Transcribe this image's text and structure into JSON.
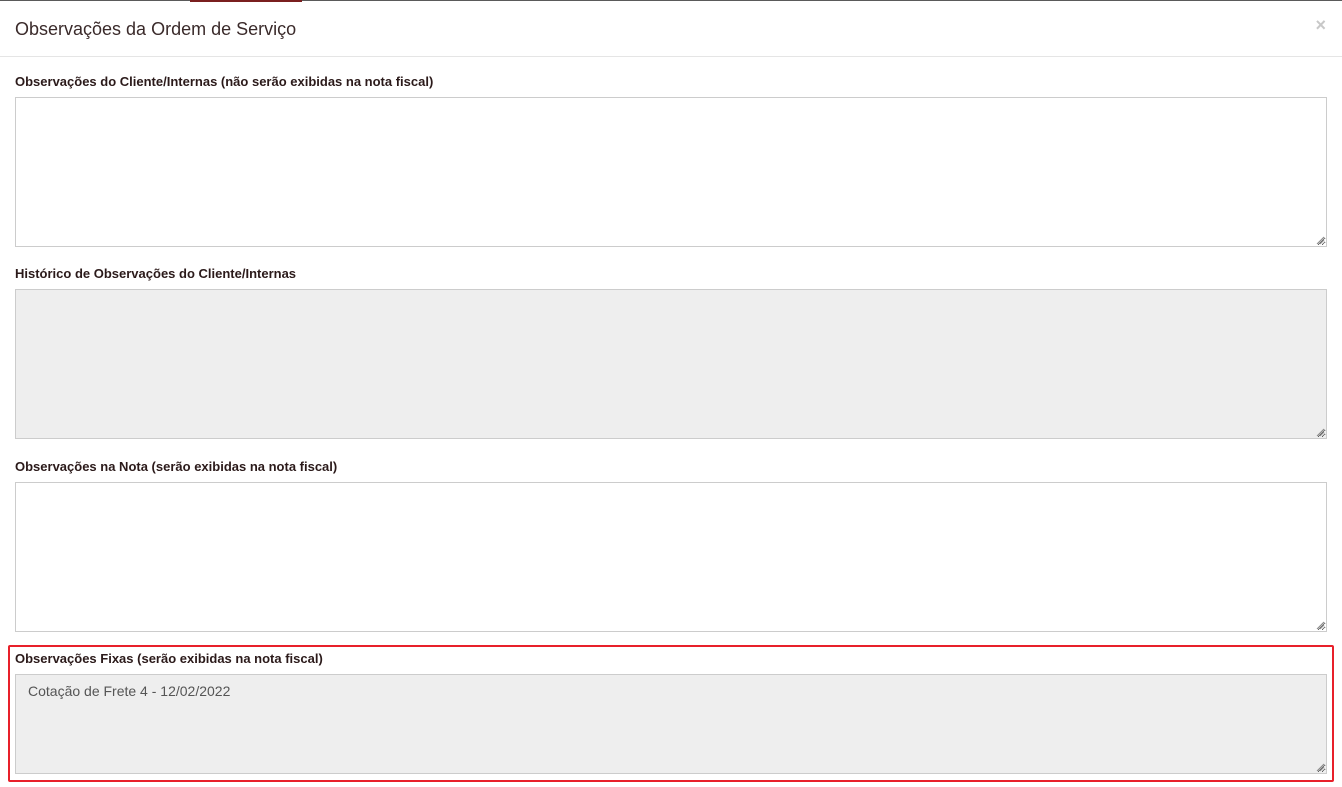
{
  "modal": {
    "title": "Observações da Ordem de Serviço",
    "close_symbol": "×"
  },
  "fields": [
    {
      "label": "Observações do Cliente/Internas (não serão exibidas na nota fiscal)",
      "value": "",
      "readonly": false
    },
    {
      "label": "Histórico de Observações do Cliente/Internas",
      "value": "",
      "readonly": true
    },
    {
      "label": "Observações na Nota (serão exibidas na nota fiscal)",
      "value": "",
      "readonly": false
    },
    {
      "label": "Observações Fixas (serão exibidas na nota fiscal)",
      "value": "Cotação de Frete 4 - 12/02/2022",
      "readonly": true
    }
  ],
  "colors": {
    "highlight": "#e8202a",
    "readonly_background": "#eeeeee",
    "title_text": "#3a2a2a"
  },
  "icons": {
    "close": "close-icon",
    "resize": "resize-grip-icon"
  }
}
